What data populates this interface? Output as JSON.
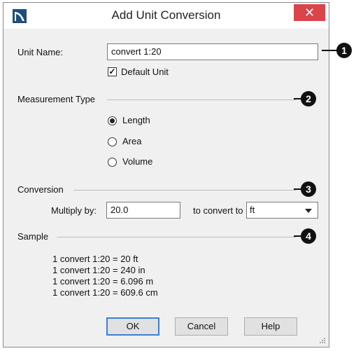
{
  "window": {
    "title": "Add Unit Conversion",
    "close_glyph": "✕"
  },
  "unit_name": {
    "label": "Unit Name:",
    "value": "convert 1:20"
  },
  "default_unit": {
    "label": "Default Unit",
    "checked": true
  },
  "measurement_type": {
    "heading": "Measurement Type",
    "options": [
      {
        "label": "Length",
        "selected": true
      },
      {
        "label": "Area",
        "selected": false
      },
      {
        "label": "Volume",
        "selected": false
      }
    ]
  },
  "conversion": {
    "heading": "Conversion",
    "multiply_label": "Multiply by:",
    "multiply_value": "20.0",
    "to_label": "to convert to",
    "unit_value": "ft"
  },
  "sample": {
    "heading": "Sample",
    "lines": [
      "1 convert 1:20 = 20 ft",
      "1 convert 1:20 = 240 in",
      "1 convert 1:20 = 6.096 m",
      "1 convert 1:20 = 609.6 cm"
    ]
  },
  "buttons": {
    "ok": "OK",
    "cancel": "Cancel",
    "help": "Help"
  },
  "callouts": [
    "1",
    "2",
    "3",
    "4"
  ],
  "colors": {
    "close_button": "#d9454a",
    "default_button_border": "#3c7fd2",
    "callout": "#111111"
  }
}
